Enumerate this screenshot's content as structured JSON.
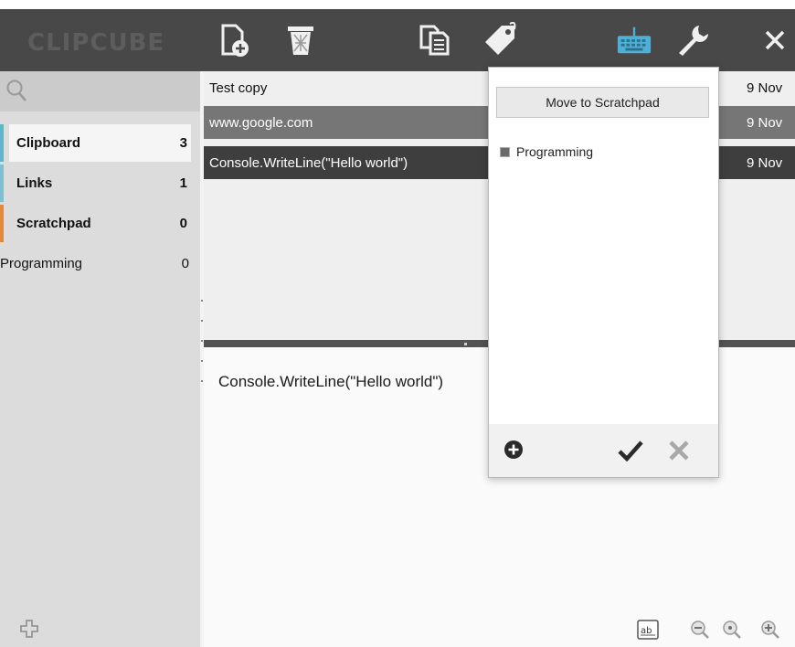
{
  "app": {
    "logo_text": "CLIPCUBE"
  },
  "toolbar": {
    "icons": [
      "new-item-icon",
      "trash-icon",
      "copy-icon",
      "tag-icon",
      "keyboard-icon",
      "wrench-icon",
      "close-icon"
    ]
  },
  "sidebar": {
    "categories": [
      {
        "name": "Clipboard",
        "count": "3",
        "color": "#5fb6c9"
      },
      {
        "name": "Links",
        "count": "1",
        "color": "#7fc0d0"
      },
      {
        "name": "Scratchpad",
        "count": "0",
        "color": "#e0883c"
      },
      {
        "name": "Programming",
        "count": "0"
      }
    ]
  },
  "items": [
    {
      "text": "Test copy",
      "date": "9 Nov"
    },
    {
      "text": "www.google.com",
      "date": "9 Nov"
    },
    {
      "text": "Console.WriteLine(\"Hello world\")",
      "date": "9 Nov"
    }
  ],
  "preview": {
    "text": "Console.WriteLine(\"Hello world\")"
  },
  "tag_popup": {
    "move_button": "Move to Scratchpad",
    "tags": [
      {
        "name": "Programming",
        "checked": false
      }
    ]
  },
  "colors": {
    "titlebar": "#484848",
    "accent_cyan": "#4fb0d6"
  }
}
